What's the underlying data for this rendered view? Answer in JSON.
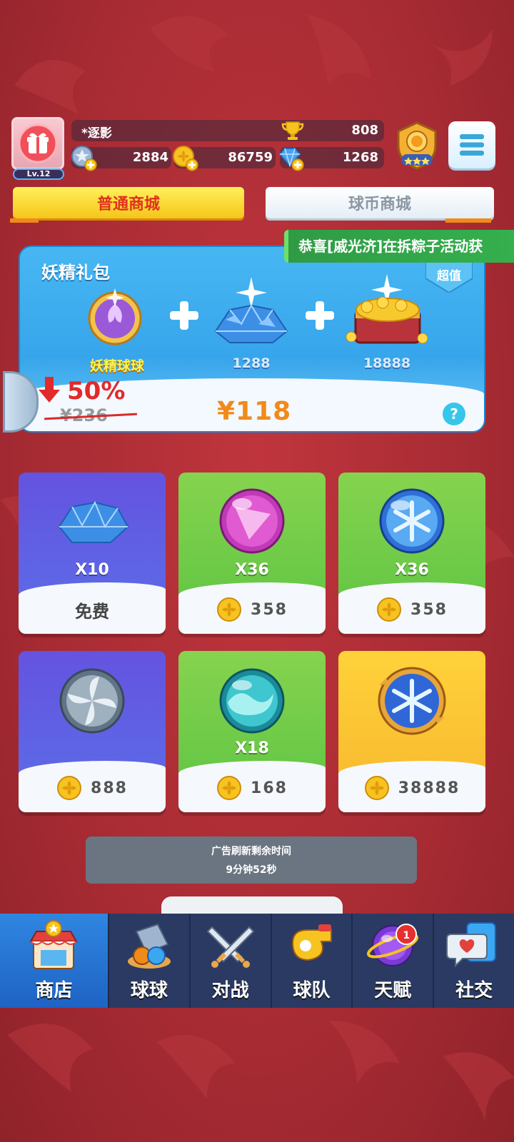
{
  "player": {
    "name": "*逐影",
    "level": "Lv.12",
    "trophies": "808",
    "energy": "2884",
    "gold": "86759",
    "gems": "1268"
  },
  "tabs": {
    "normal": "普通商城",
    "coin": "球币商城"
  },
  "marquee": "恭喜[戚光济]在拆粽子活动获",
  "pack": {
    "title": "妖精礼包",
    "tag": "超值",
    "items": [
      {
        "label": "妖精球球",
        "icon": "fairy-ball-icon"
      },
      {
        "label": "1288",
        "icon": "gem-pile-icon"
      },
      {
        "label": "18888",
        "icon": "gold-chest-icon"
      }
    ],
    "discount": "50%",
    "old_price": "¥236",
    "price": "¥118",
    "help": "?"
  },
  "shop": [
    {
      "qty": "X10",
      "price": "免费",
      "color": "#6453e0",
      "icon": "gem-icon",
      "free": true
    },
    {
      "qty": "X36",
      "price": "358",
      "color": "#86d34e",
      "icon": "pink-ball-icon"
    },
    {
      "qty": "X36",
      "price": "358",
      "color": "#86d34e",
      "icon": "ice-ball-icon"
    },
    {
      "qty": "",
      "price": "888",
      "color": "#6453e0",
      "icon": "swirl-ball-icon"
    },
    {
      "qty": "X18",
      "price": "168",
      "color": "#86d34e",
      "icon": "wave-ball-icon"
    },
    {
      "qty": "",
      "price": "38888",
      "color": "#ffd23a",
      "icon": "frost-ball-icon"
    }
  ],
  "timer": {
    "line1": "广告刷新剩余时间",
    "line2": "9分钟52秒"
  },
  "nav": [
    {
      "label": "商店",
      "icon": "shop-icon",
      "active": true
    },
    {
      "label": "球球",
      "icon": "ball-cannon-icon"
    },
    {
      "label": "对战",
      "icon": "crossed-swords-icon"
    },
    {
      "label": "球队",
      "icon": "whistle-icon"
    },
    {
      "label": "天赋",
      "icon": "talent-orb-icon",
      "badge": "1"
    },
    {
      "label": "社交",
      "icon": "chat-heart-icon"
    }
  ]
}
